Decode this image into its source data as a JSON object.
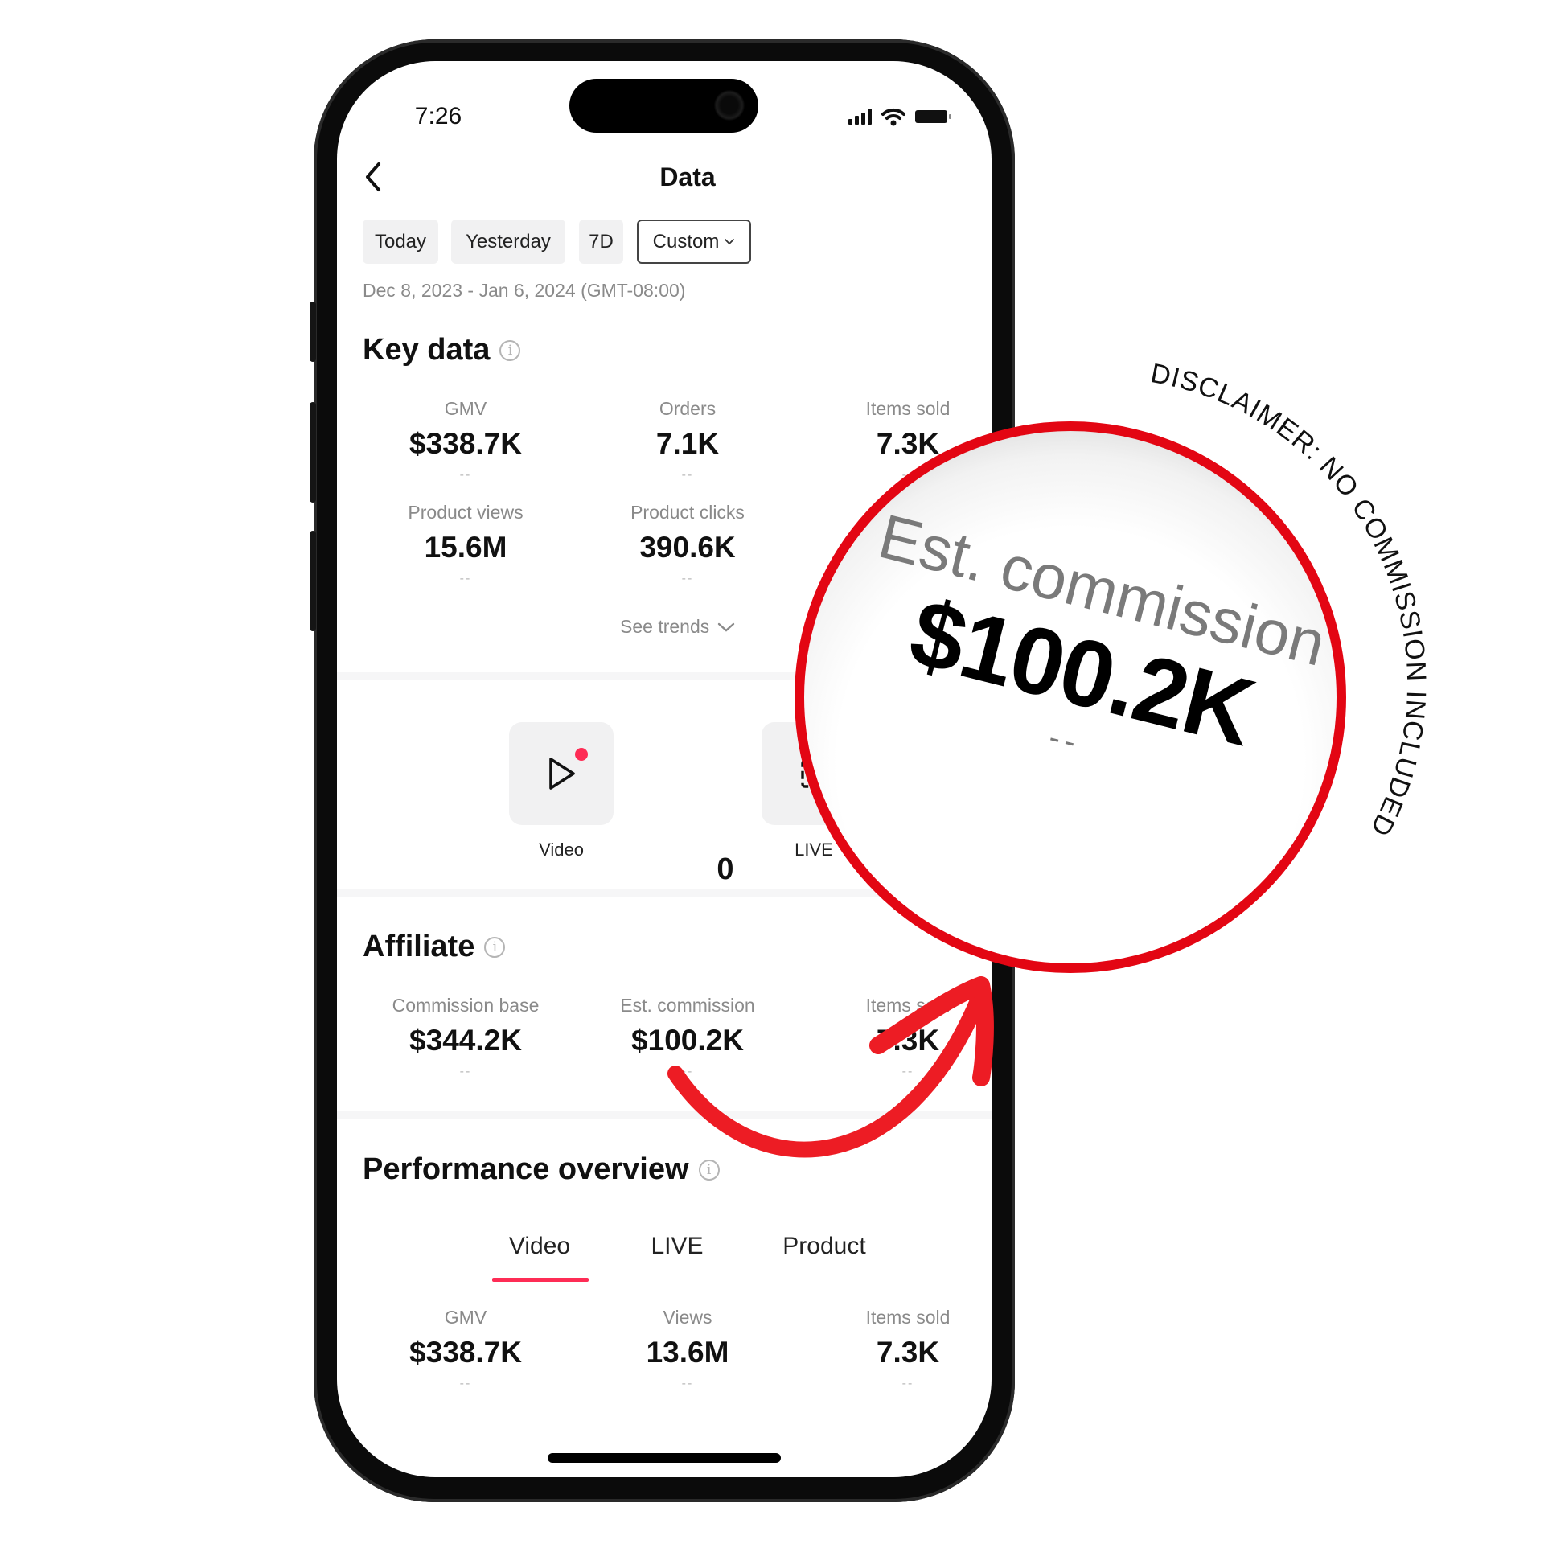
{
  "status_bar": {
    "time": "7:26",
    "icons": [
      "signal-icon",
      "wifi-icon",
      "battery-icon"
    ]
  },
  "header": {
    "title": "Data",
    "back_icon": "chevron-left-icon"
  },
  "date_filter": {
    "chips": [
      {
        "label": "Today",
        "selected": false
      },
      {
        "label": "Yesterday",
        "selected": false
      },
      {
        "label": "7D",
        "selected": false
      },
      {
        "label": "Custom",
        "selected": true,
        "icon": "chevron-down-icon"
      }
    ],
    "range": "Dec 8, 2023 - Jan 6, 2024 (GMT-08:00)"
  },
  "key_data": {
    "title": "Key data",
    "metrics": [
      {
        "label": "GMV",
        "value": "$338.7K",
        "change": "--"
      },
      {
        "label": "Orders",
        "value": "7.1K",
        "change": "--"
      },
      {
        "label": "Items sold",
        "value": "7.3K",
        "change": "--"
      },
      {
        "label": "Product views",
        "value": "15.6M",
        "change": "--"
      },
      {
        "label": "Product clicks",
        "value": "390.6K",
        "change": "--"
      }
    ],
    "see_trends": "See trends"
  },
  "content_types": {
    "items": [
      {
        "label": "Video",
        "icon": "play-icon",
        "has_badge": true,
        "badge_color": "#fe2c55"
      },
      {
        "label": "LIVE",
        "icon": "live-icon",
        "has_badge": false
      }
    ],
    "count": "0"
  },
  "affiliate": {
    "title": "Affiliate",
    "metrics": [
      {
        "label": "Commission base",
        "value": "$344.2K",
        "change": "--"
      },
      {
        "label": "Est. commission",
        "value": "$100.2K",
        "change": "--"
      },
      {
        "label": "Items sold",
        "value": "7.3K",
        "change": "--"
      }
    ]
  },
  "performance_overview": {
    "title": "Performance overview",
    "tabs": [
      {
        "label": "Video",
        "active": true
      },
      {
        "label": "LIVE",
        "active": false
      },
      {
        "label": "Product",
        "active": false
      }
    ],
    "metrics": [
      {
        "label": "GMV",
        "value": "$338.7K",
        "change": "--"
      },
      {
        "label": "Views",
        "value": "13.6M",
        "change": "--"
      },
      {
        "label": "Items sold",
        "value": "7.3K",
        "change": "--"
      }
    ]
  },
  "annotation": {
    "magnified_label": "Est. commission",
    "magnified_value": "$100.2K",
    "magnified_change": "--",
    "disclaimer": "DISCLAIMER: NO COMMISSION INCLUDED",
    "accent_color": "#e30613",
    "arrow_color": "#ed1c24"
  },
  "colors": {
    "accent_pink": "#fe2c55",
    "text_primary": "#111111",
    "text_secondary": "#8a8a8a",
    "chip_bg": "#f1f1f2"
  }
}
